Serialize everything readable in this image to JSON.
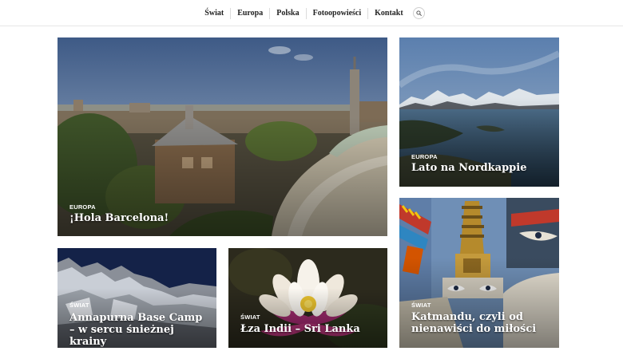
{
  "nav": {
    "items": [
      {
        "label": "Świat"
      },
      {
        "label": "Europa"
      },
      {
        "label": "Polska"
      },
      {
        "label": "Fotoopowieści"
      },
      {
        "label": "Kontakt"
      }
    ],
    "search_icon": "search-icon"
  },
  "posts": {
    "barcelona": {
      "category": "Europa",
      "title": "¡Hola Barcelona!"
    },
    "nordkapp": {
      "category": "Europa",
      "title": "Lato na Nordkappie"
    },
    "annapurna": {
      "category": "Świat",
      "title": "Annapurna Base Camp – w sercu śnieżnej krainy"
    },
    "srilanka": {
      "category": "Świat",
      "title": "Łza Indii – Sri Lanka"
    },
    "katmandu": {
      "category": "Świat",
      "title": "Katmandu, czyli od nienawiści do miłości"
    }
  },
  "colors": {
    "text": "#222222",
    "overlay_text": "#ffffff",
    "divider": "#dcdcdc"
  }
}
